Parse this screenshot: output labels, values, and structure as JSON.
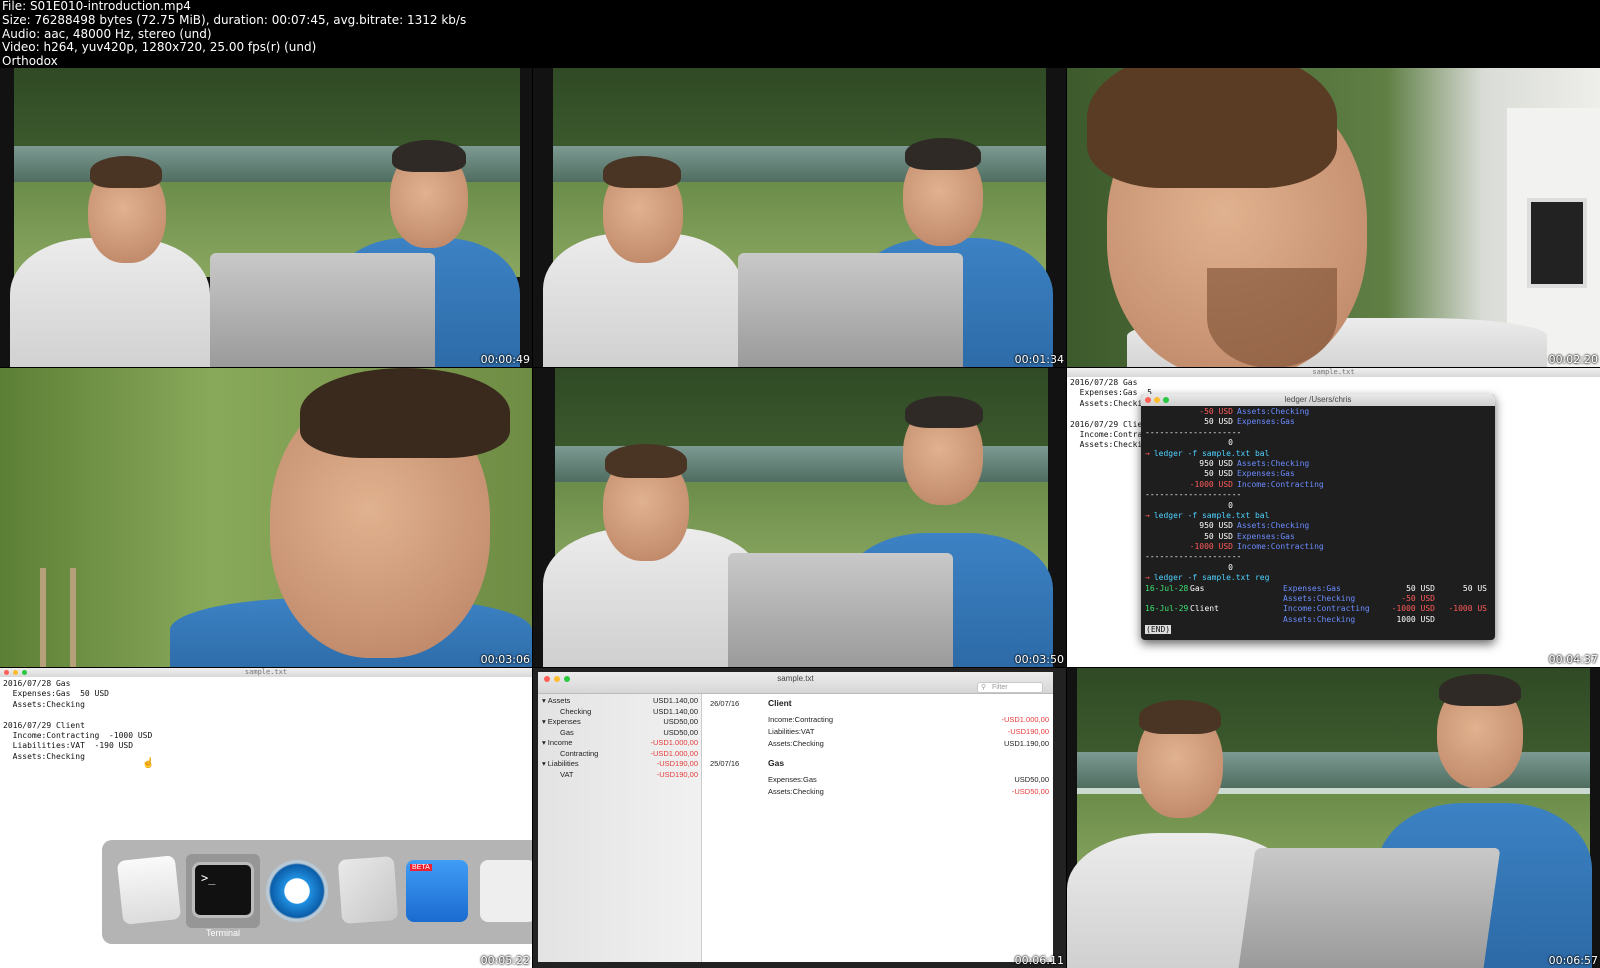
{
  "header": {
    "file": "File: S01E010-introduction.mp4",
    "size": "Size: 76288498 bytes (72.75 MiB), duration: 00:07:45, avg.bitrate: 1312 kb/s",
    "audio": "Audio: aac, 48000 Hz, stereo (und)",
    "video": "Video: h264, yuv420p, 1280x720, 25.00 fps(r) (und)",
    "title": "Orthodox"
  },
  "thumbnails": [
    {
      "timestamp": "00:00:49"
    },
    {
      "timestamp": "00:01:34"
    },
    {
      "timestamp": "00:02:20"
    },
    {
      "timestamp": "00:03:06"
    },
    {
      "timestamp": "00:03:50"
    },
    {
      "timestamp": "00:04:37"
    },
    {
      "timestamp": "00:05:22"
    },
    {
      "timestamp": "00:06:11"
    },
    {
      "timestamp": "00:06:57"
    }
  ],
  "laptop_logo": "",
  "editor6": {
    "title": "sample.txt",
    "lines": [
      "2016/07/28 Gas",
      "  Expenses:Gas  5",
      "  Assets:Checkin",
      "",
      "2016/07/29 Client",
      "  Income:Contract",
      "  Assets:Checkin"
    ]
  },
  "terminal": {
    "title": "ledger  /Users/chris",
    "lines": [
      {
        "amount": "-50 USD",
        "account": "Assets:Checking"
      },
      {
        "amount": "50 USD",
        "account": "Expenses:Gas"
      },
      {
        "sep": "--------------------"
      },
      {
        "amount": "0"
      },
      {
        "cmd": "ledger -f sample.txt bal"
      },
      {
        "amount": "950 USD",
        "account": "Assets:Checking"
      },
      {
        "amount": "50 USD",
        "account": "Expenses:Gas"
      },
      {
        "amount": "-1000 USD",
        "account": "Income:Contracting"
      },
      {
        "sep": "--------------------"
      },
      {
        "amount": "0"
      },
      {
        "cmd": "ledger -f sample.txt bal"
      },
      {
        "amount": "950 USD",
        "account": "Assets:Checking"
      },
      {
        "amount": "50 USD",
        "account": "Expenses:Gas"
      },
      {
        "amount": "-1000 USD",
        "account": "Income:Contracting"
      },
      {
        "sep": "--------------------"
      },
      {
        "amount": "0"
      },
      {
        "cmd": "ledger -f sample.txt reg"
      }
    ],
    "reg": [
      {
        "date": "16-Jul-28",
        "payee": "Gas",
        "account": "Expenses:Gas",
        "amount": "50 USD",
        "total": "50 US"
      },
      {
        "account": "Assets:Checking",
        "amount": "-50 USD"
      },
      {
        "date": "16-Jul-29",
        "payee": "Client",
        "account": "Income:Contracting",
        "amount": "-1000 USD",
        "total": "-1000 US"
      },
      {
        "account": "Assets:Checking",
        "amount": "1000 USD"
      }
    ],
    "status": "(END)",
    "prompt": "→"
  },
  "editor7": {
    "title": "sample.txt",
    "lines": [
      "2016/07/28 Gas",
      "  Expenses:Gas  50 USD",
      "  Assets:Checking",
      "",
      "2016/07/29 Client",
      "  Income:Contracting  -1000 USD",
      "  Liabilities:VAT  -190 USD",
      "  Assets:Checking"
    ]
  },
  "dock": {
    "terminal_label": "Terminal",
    "terminal_glyph": ">_",
    "beta_badge": "BETA"
  },
  "finance": {
    "title": "sample.txt",
    "filter_placeholder": "Filter",
    "tree": [
      {
        "label": "Assets",
        "value": "USD1.140,00",
        "level": 0,
        "neg": false
      },
      {
        "label": "Checking",
        "value": "USD1.140,00",
        "level": 1,
        "neg": false
      },
      {
        "label": "Expenses",
        "value": "USD50,00",
        "level": 0,
        "neg": false
      },
      {
        "label": "Gas",
        "value": "USD50,00",
        "level": 1,
        "neg": false
      },
      {
        "label": "Income",
        "value": "-USD1.000,00",
        "level": 0,
        "neg": true
      },
      {
        "label": "Contracting",
        "value": "-USD1.000,00",
        "level": 1,
        "neg": true
      },
      {
        "label": "Liabilities",
        "value": "-USD190,00",
        "level": 0,
        "neg": true
      },
      {
        "label": "VAT",
        "value": "-USD190,00",
        "level": 1,
        "neg": true
      }
    ],
    "transactions": [
      {
        "date": "26/07/16",
        "payee": "Client",
        "postings": [
          {
            "account": "Income:Contracting",
            "amount": "-USD1.000,00",
            "neg": true
          },
          {
            "account": "Liabilities:VAT",
            "amount": "-USD190,00",
            "neg": true
          },
          {
            "account": "Assets:Checking",
            "amount": "USD1.190,00",
            "neg": false
          }
        ]
      },
      {
        "date": "25/07/16",
        "payee": "Gas",
        "postings": [
          {
            "account": "Expenses:Gas",
            "amount": "USD50,00",
            "neg": false
          },
          {
            "account": "Assets:Checking",
            "amount": "-USD50,00",
            "neg": true
          }
        ]
      }
    ]
  },
  "colors": {
    "accent_red": "#e53b3b",
    "terminal_bg": "#1e1e1e",
    "account_blue": "#6b8cff",
    "cmd_cyan": "#4fd2ff"
  }
}
